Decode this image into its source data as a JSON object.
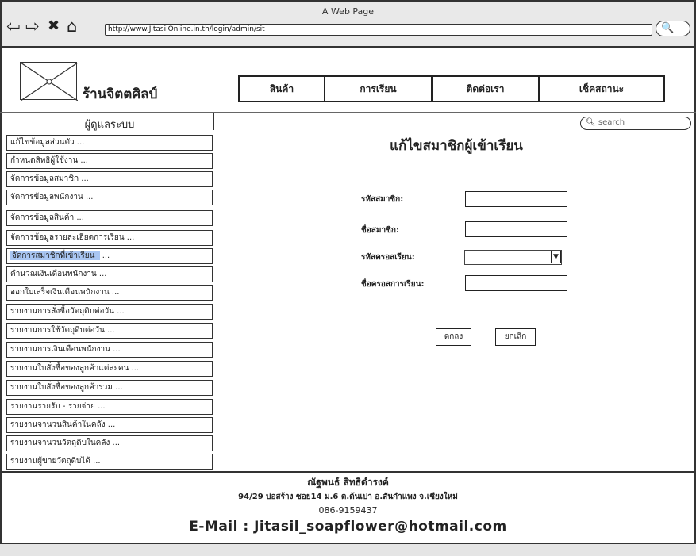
{
  "window": {
    "title": "A Web Page",
    "url": "http://www.JitasilOnline.in.th/login/admin/sit"
  },
  "icons": {
    "back": "left-arrow-icon",
    "forward": "right-arrow-icon",
    "close": "close-icon",
    "home": "home-icon",
    "search": "search-icon"
  },
  "header": {
    "shop_name": "ร้านจิตตศิลป์"
  },
  "menu": [
    {
      "label": "สินค้า"
    },
    {
      "label": "การเรียน"
    },
    {
      "label": "ติดต่อเรา"
    },
    {
      "label": "เช็คสถานะ"
    }
  ],
  "sidebar": {
    "title": "ผู้ดูแลระบบ",
    "items": [
      {
        "label": "แก้ไขข้อมูลส่วนตัว ..."
      },
      {
        "label": "กำหนดสิทธิผู้ใช้งาน ..."
      },
      {
        "label": "จัดการข้อมูลสมาชิก ..."
      },
      {
        "label": "จัดการข้อมูลพนักงาน ..."
      },
      {
        "label": "จัดการข้อมูลสินค้า ..."
      },
      {
        "label": "จัดการข้อมูลรายละเอียดการเรียน ..."
      },
      {
        "label": "จัดการสมาชิกที่เข้าเรียน",
        "suffix": "..."
      },
      {
        "label": "คำนวณเงินเดือนพนักงาน ..."
      },
      {
        "label": "ออกใบเสร็จเงินเดือนพนักงาน ..."
      },
      {
        "label": "รายงานการสั่งซื้อวัตถุดิบต่อวัน ..."
      },
      {
        "label": "รายงานการใช้วัตถุดิบต่อวัน ..."
      },
      {
        "label": "รายงานการเงินเดือนพนักงาน ..."
      },
      {
        "label": "รายงานใบสั่งซื้อของลูกค้าแต่ละคน ..."
      },
      {
        "label": "รายงานใบสั่งซื้อของลูกค้ารวม ..."
      },
      {
        "label": "รายงานรายรับ - รายจ่าย ..."
      },
      {
        "label": "รายงานจานวนสินค้าในคลัง ..."
      },
      {
        "label": "รายงานจานวนวัตถุดิบในคลัง ..."
      },
      {
        "label": "รายงานผู้ขายวัตถุดิบได้ ..."
      }
    ]
  },
  "search": {
    "placeholder": "search"
  },
  "form": {
    "title": "แก้ไขสมาชิกผู้เข้าเรียน",
    "member_id_label": "รหัสสมาชิก:",
    "member_id_value": "",
    "member_name_label": "ชื่อสมาชิก:",
    "member_name_value": "",
    "course_id_label": "รหัสครอสเรียน:",
    "course_id_value": "",
    "course_name_label": "ชื่อครอสการเรียน:",
    "course_name_value": "",
    "ok_label": "ตกลง",
    "cancel_label": "ยกเลิก"
  },
  "footer": {
    "name": "ณัฐพนธ์ สิทธิดำรงค์",
    "address": "94/29 บ่อสร้าง ซอย14 ม.6 ต.ต้นเปา อ.สันกำแพง จ.เชียงใหม่",
    "phone": "086-9159437",
    "email": "E-Mail : Jitasil_soapflower@hotmail.com"
  }
}
